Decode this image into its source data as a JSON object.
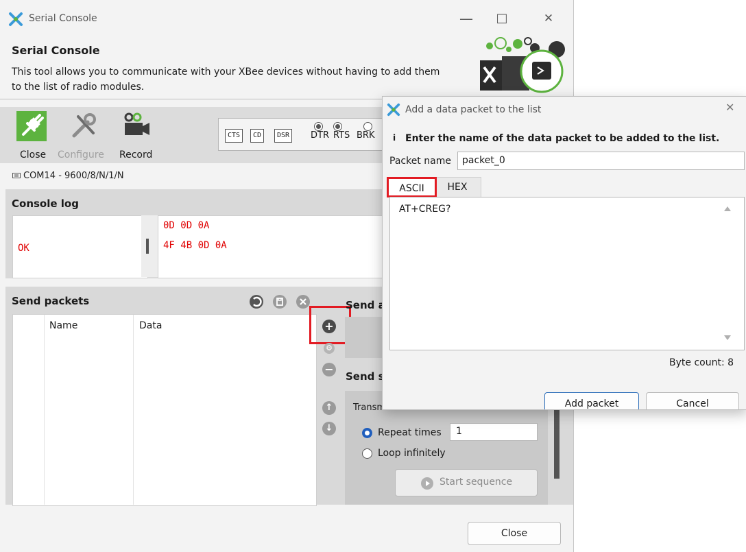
{
  "window": {
    "title": "Serial Console",
    "header_title": "Serial Console",
    "header_desc": "This tool allows you to communicate with your XBee devices without having to add them to the list of radio modules.",
    "minimize_glyph": "—",
    "maximize_glyph": "□",
    "close_glyph": "✕"
  },
  "toolbar": {
    "close_label": "Close",
    "configure_label": "Configure",
    "record_label": "Record",
    "signals": [
      "CTS",
      "CD",
      "DSR"
    ],
    "lines": [
      "DTR",
      "RTS",
      "BRK"
    ],
    "line_states": [
      true,
      true,
      false
    ]
  },
  "port": {
    "text": "COM14 - 9600/8/N/1/N"
  },
  "console_log": {
    "title": "Console log",
    "ascii_lines": [
      "",
      "OK"
    ],
    "hex_lines": [
      "0D 0D 0A",
      "4F 4B 0D 0A"
    ]
  },
  "send_packets": {
    "title": "Send packets",
    "columns": [
      "Name",
      "Data"
    ],
    "send_single_title": "Send a",
    "send_sequence_title": "Send s",
    "transmit_label": "Transm",
    "repeat_label": "Repeat times",
    "repeat_value": "1",
    "loop_label": "Loop infinitely",
    "start_sequence_label": "Start sequence"
  },
  "footer": {
    "close_label": "Close"
  },
  "dialog": {
    "title": "Add a data packet to the list",
    "info_glyph": "i",
    "instruction": "Enter the name of the data packet to be added to the list.",
    "packet_name_label": "Packet name",
    "packet_name_value": "packet_0",
    "tabs": [
      "ASCII",
      "HEX"
    ],
    "active_tab": "ASCII",
    "data_text": "AT+CREG?",
    "byte_count": "Byte count: 8",
    "add_label": "Add packet",
    "cancel_label": "Cancel",
    "close_glyph": "✕"
  },
  "colors": {
    "accent_red": "#e21b23",
    "connect_green": "#5db33f",
    "console_red": "#e00000",
    "button_border_blue": "#2f6fba"
  },
  "icons": [
    "app-icon",
    "connect-plug-icon",
    "tools-icon",
    "camera-icon",
    "serial-port-icon",
    "sequence-icon",
    "save-icon",
    "clear-icon",
    "add-icon",
    "settings-icon",
    "remove-icon",
    "arrow-up-icon",
    "arrow-down-icon",
    "play-icon",
    "info-icon",
    "console-logo-icon"
  ]
}
